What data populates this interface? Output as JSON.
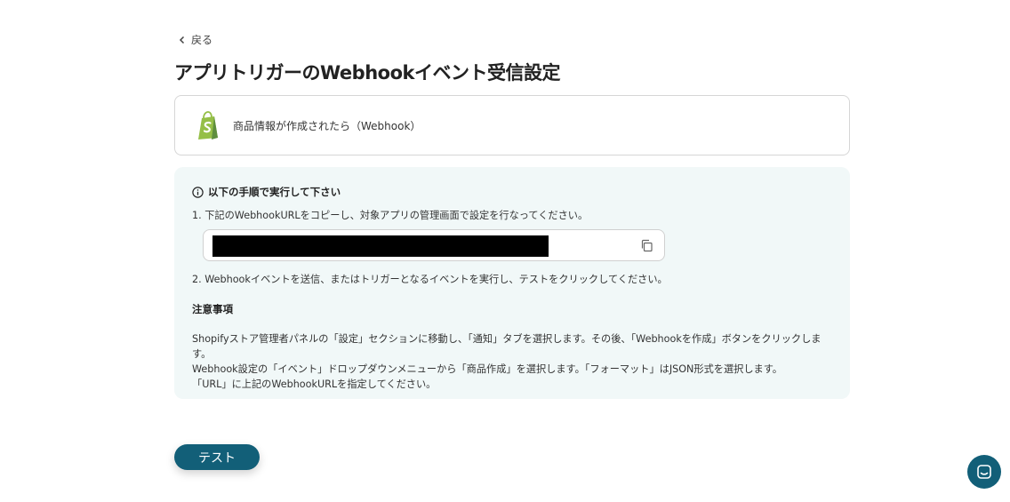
{
  "nav": {
    "back_label": "戻る"
  },
  "page_title": "アプリトリガーのWebhookイベント受信設定",
  "trigger": {
    "label": "商品情報が作成されたら（Webhook）",
    "app_icon": "shopify-icon",
    "brand_color": "#95bf47"
  },
  "instructions": {
    "header": "以下の手順で実行して下さい",
    "step1": "1. 下記のWebhookURLをコピーし、対象アプリの管理画面で設定を行なってください。",
    "webhook_url_redacted": true,
    "step2": "2. Webhookイベントを送信、またはトリガーとなるイベントを実行し、テストをクリックしてください。",
    "notes_title": "注意事項",
    "notes": [
      "Shopifyストア管理者パネルの「設定」セクションに移動し、「通知」タブを選択します。その後、「Webhookを作成」ボタンをクリックしま",
      "す。",
      "Webhook設定の「イベント」ドロップダウンメニューから「商品作成」を選択します。「フォーマット」はJSON形式を選択します。",
      "「URL」に上記のWebhookURLを指定してください。"
    ]
  },
  "test_button_label": "テスト",
  "colors": {
    "primary": "#125f78",
    "instructions_bg": "#f1f8f8"
  }
}
